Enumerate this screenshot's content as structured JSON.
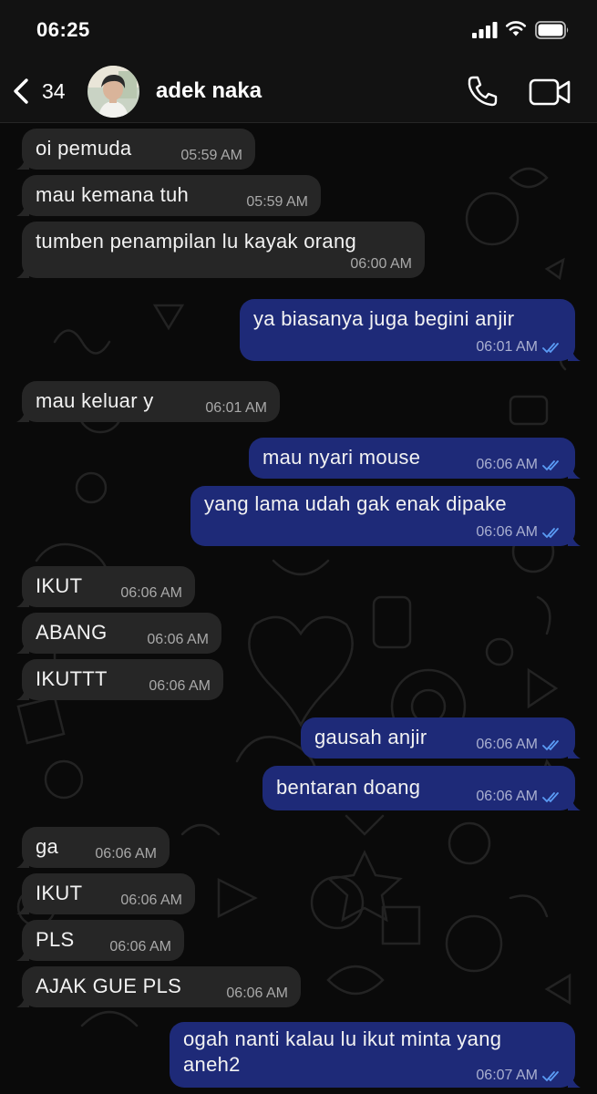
{
  "status_bar": {
    "time": "06:25"
  },
  "header": {
    "back_count": "34",
    "contact_name": "adek naka"
  },
  "colors": {
    "incoming_bubble": "#262626",
    "outgoing_bubble": "#1e2a78",
    "read_ticks": "#5b9cf5",
    "background": "#0b0b0b"
  },
  "messages": [
    {
      "dir": "in",
      "text": "oi pemuda",
      "time": "05:59 AM"
    },
    {
      "dir": "in",
      "text": "mau kemana tuh",
      "time": "05:59 AM"
    },
    {
      "dir": "in",
      "text": "tumben penampilan lu kayak orang",
      "time": "06:00 AM"
    },
    {
      "dir": "out",
      "text": "ya biasanya juga begini anjir",
      "time": "06:01 AM",
      "status": "read"
    },
    {
      "dir": "in",
      "text": "mau keluar y",
      "time": "06:01 AM"
    },
    {
      "dir": "out",
      "text": "mau nyari mouse",
      "time": "06:06 AM",
      "status": "read"
    },
    {
      "dir": "out",
      "text": "yang lama udah gak enak dipake",
      "time": "06:06 AM",
      "status": "read"
    },
    {
      "dir": "in",
      "text": "IKUT",
      "time": "06:06 AM"
    },
    {
      "dir": "in",
      "text": "ABANG",
      "time": "06:06 AM"
    },
    {
      "dir": "in",
      "text": "IKUTTT",
      "time": "06:06 AM"
    },
    {
      "dir": "out",
      "text": "gausah anjir",
      "time": "06:06 AM",
      "status": "read"
    },
    {
      "dir": "out",
      "text": "bentaran doang",
      "time": "06:06 AM",
      "status": "read"
    },
    {
      "dir": "in",
      "text": "ga",
      "time": "06:06 AM"
    },
    {
      "dir": "in",
      "text": "IKUT",
      "time": "06:06 AM"
    },
    {
      "dir": "in",
      "text": "PLS",
      "time": "06:06 AM"
    },
    {
      "dir": "in",
      "text": "AJAK GUE PLS",
      "time": "06:06 AM"
    },
    {
      "dir": "out",
      "text": "ogah nanti kalau lu ikut minta yang aneh2",
      "time": "06:07 AM",
      "status": "read"
    }
  ]
}
